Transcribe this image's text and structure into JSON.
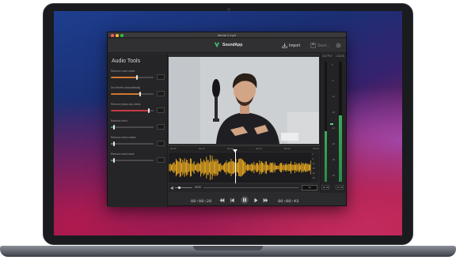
{
  "window": {
    "title": "Media 2.mp4"
  },
  "toolbar": {
    "app_name": "SoundApp",
    "import_label": "Import",
    "save_label": "Save...",
    "brand_color": "#3fbf6e"
  },
  "sidebar": {
    "heading": "Audio Tools",
    "tools": [
      {
        "label": "Remove room noise",
        "value": "",
        "level": 0.62,
        "color": "#d2772f"
      },
      {
        "label": "De-Reverb automatically",
        "value": "",
        "level": 0.7,
        "color": "#d2772f"
      },
      {
        "label": "Remove plops and clicks",
        "value": "",
        "level": 0.9,
        "color": "#c83a45"
      },
      {
        "label": "Remove echo",
        "value": "",
        "level": 0.05,
        "color": "#3aa06a"
      },
      {
        "label": "Remove wind rustles",
        "value": "",
        "level": 0.05,
        "color": "#3aa06a"
      },
      {
        "label": "Remove wind noise",
        "value": "",
        "level": 0.05,
        "color": "#3aa06a"
      }
    ]
  },
  "timeline": {
    "ruler": [
      "00:00",
      "00:10",
      "00:20",
      "00:30",
      "00:40",
      "00:50"
    ],
    "wave_scale": [
      "0",
      "-6",
      "-12",
      "-18",
      "-24",
      "-30"
    ],
    "wave_color": "#f2b021"
  },
  "mini_transport": {
    "time_left": "00:00",
    "time_right": "00:43",
    "select_label": "1x"
  },
  "transport": {
    "current_time": "00:00:20",
    "total_time": "00:00:43"
  },
  "meters": {
    "output_label": "OUTPUT",
    "loudness_label": "LOUDN",
    "ticks": [
      "0",
      "-6",
      "-12",
      "-18",
      "-24",
      "-30",
      "-36",
      "-42"
    ],
    "output_level": 0.42,
    "loudness_level": 0.55,
    "foot_left": "-00:00",
    "foot_right": "-00:00"
  }
}
